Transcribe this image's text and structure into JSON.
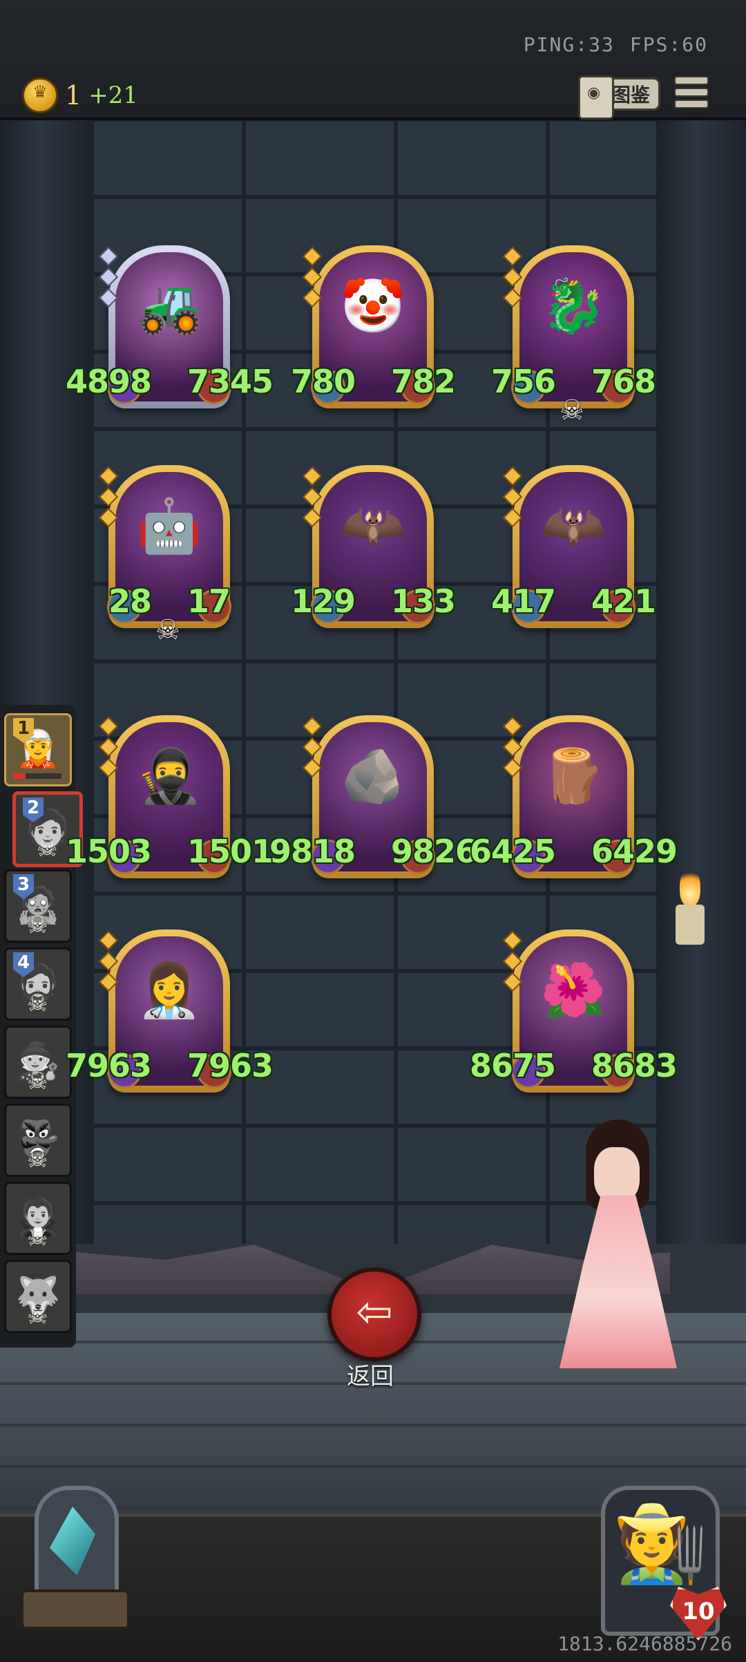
{
  "hud": {
    "ping": "PING:33",
    "fps": "FPS:60",
    "coins": "1",
    "coin_gain": "+21",
    "codex_label": "图鉴"
  },
  "cards": [
    {
      "name": "mech-cart-gang",
      "atk": "4898",
      "hp": "7345",
      "frame": "silver",
      "badge": "purple",
      "skull": false,
      "portrait": "🚜",
      "art": "#b46fb8"
    },
    {
      "name": "jester-clown",
      "atk": "780",
      "hp": "782",
      "frame": "gold",
      "badge": "normal",
      "skull": false,
      "portrait": "🤡",
      "art": "#a24fa0"
    },
    {
      "name": "fire-dragon",
      "atk": "756",
      "hp": "768",
      "frame": "gold",
      "badge": "normal",
      "skull": true,
      "portrait": "🐉",
      "art": "#8e3f9a"
    },
    {
      "name": "robot-golem",
      "atk": "28",
      "hp": "17",
      "frame": "gold",
      "badge": "normal",
      "skull": true,
      "portrait": "🤖",
      "art": "#8a4a9c"
    },
    {
      "name": "shadow-wyvern",
      "atk": "129",
      "hp": "133",
      "frame": "gold",
      "badge": "normal",
      "skull": false,
      "portrait": "🦇",
      "art": "#6e3b8c"
    },
    {
      "name": "shadow-wyvern-2",
      "atk": "417",
      "hp": "421",
      "frame": "gold",
      "badge": "normal",
      "skull": false,
      "portrait": "🦇",
      "art": "#6e3b8c"
    },
    {
      "name": "hooded-ninja",
      "atk": "1503",
      "hp": "1501",
      "frame": "gold",
      "badge": "purple",
      "skull": false,
      "portrait": "🥷",
      "art": "#7a3a8a"
    },
    {
      "name": "rock-blob",
      "atk": "9818",
      "hp": "9826",
      "frame": "gold",
      "badge": "purple",
      "skull": false,
      "portrait": "🪨",
      "art": "#8c4e9c"
    },
    {
      "name": "tree-ent",
      "atk": "6425",
      "hp": "6429",
      "frame": "gold",
      "badge": "purple",
      "skull": false,
      "portrait": "🪵",
      "art": "#9b4f88"
    },
    {
      "name": "medic-woman",
      "atk": "7963",
      "hp": "7963",
      "frame": "gold",
      "badge": "purple",
      "skull": false,
      "portrait": "👩‍⚕️",
      "art": "#9a5aa6"
    },
    {
      "name": "flower-elf",
      "atk": "8675",
      "hp": "8683",
      "frame": "gold",
      "badge": "purple",
      "skull": false,
      "portrait": "🌺",
      "art": "#a05aa0"
    }
  ],
  "roster": [
    {
      "num": "1",
      "state": "active",
      "dead": false,
      "face": "🧝"
    },
    {
      "num": "2",
      "state": "selected",
      "dead": true,
      "face": "🧑"
    },
    {
      "num": "3",
      "state": "dead",
      "dead": true,
      "face": "🧟"
    },
    {
      "num": "4",
      "state": "dead",
      "dead": true,
      "face": "🧔"
    },
    {
      "num": "",
      "state": "dead",
      "dead": true,
      "face": "🧙"
    },
    {
      "num": "",
      "state": "dead",
      "dead": true,
      "face": "👺"
    },
    {
      "num": "",
      "state": "dead",
      "dead": true,
      "face": "🧛"
    },
    {
      "num": "",
      "state": "dead",
      "dead": true,
      "face": "🐺"
    }
  ],
  "back_label": "返回",
  "player_level": "10",
  "coords_text": "1813.6246885726",
  "colors": {
    "stat_text": "#9ff06f",
    "back_button": "#c8322f",
    "gold_frame": "#f2c55a"
  }
}
